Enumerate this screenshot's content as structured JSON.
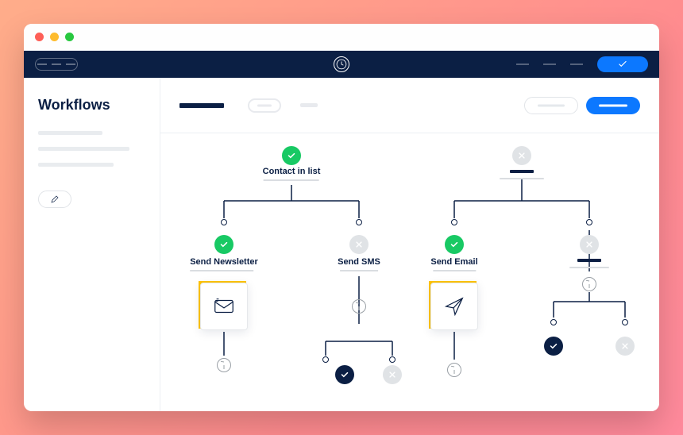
{
  "sidebar": {
    "title": "Workflows"
  },
  "nodes": {
    "contact": "Contact in list",
    "newsletter": "Send Newsletter",
    "sms": "Send SMS",
    "email": "Send Email"
  }
}
